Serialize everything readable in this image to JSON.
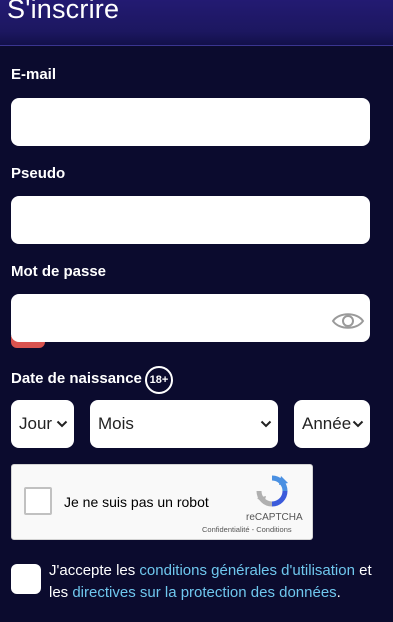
{
  "header": {
    "title": "S'inscrire"
  },
  "form": {
    "email": {
      "label": "E-mail",
      "value": "",
      "placeholder": ""
    },
    "username": {
      "label": "Pseudo",
      "value": "",
      "placeholder": ""
    },
    "password": {
      "label": "Mot de passe",
      "value": "",
      "placeholder": ""
    },
    "birthdate": {
      "label": "Date de naissance",
      "age_badge": "18+",
      "day": "Jour",
      "month": "Mois",
      "year": "Année"
    }
  },
  "captcha": {
    "label": "Je ne suis pas un robot",
    "brand": "reCAPTCHA",
    "privacy": "Confidentialité",
    "separator": " - ",
    "terms": "Conditions"
  },
  "agreement": {
    "text_1": "J'accepte les ",
    "link_1": "conditions générales d'utilisation",
    "text_2": " et les ",
    "link_2": "directives sur la protection des données",
    "text_3": "."
  },
  "colors": {
    "background": "#0b0b2e",
    "header": "#1c1760",
    "link": "#6fc7ee",
    "error_tab": "#d9534f"
  }
}
